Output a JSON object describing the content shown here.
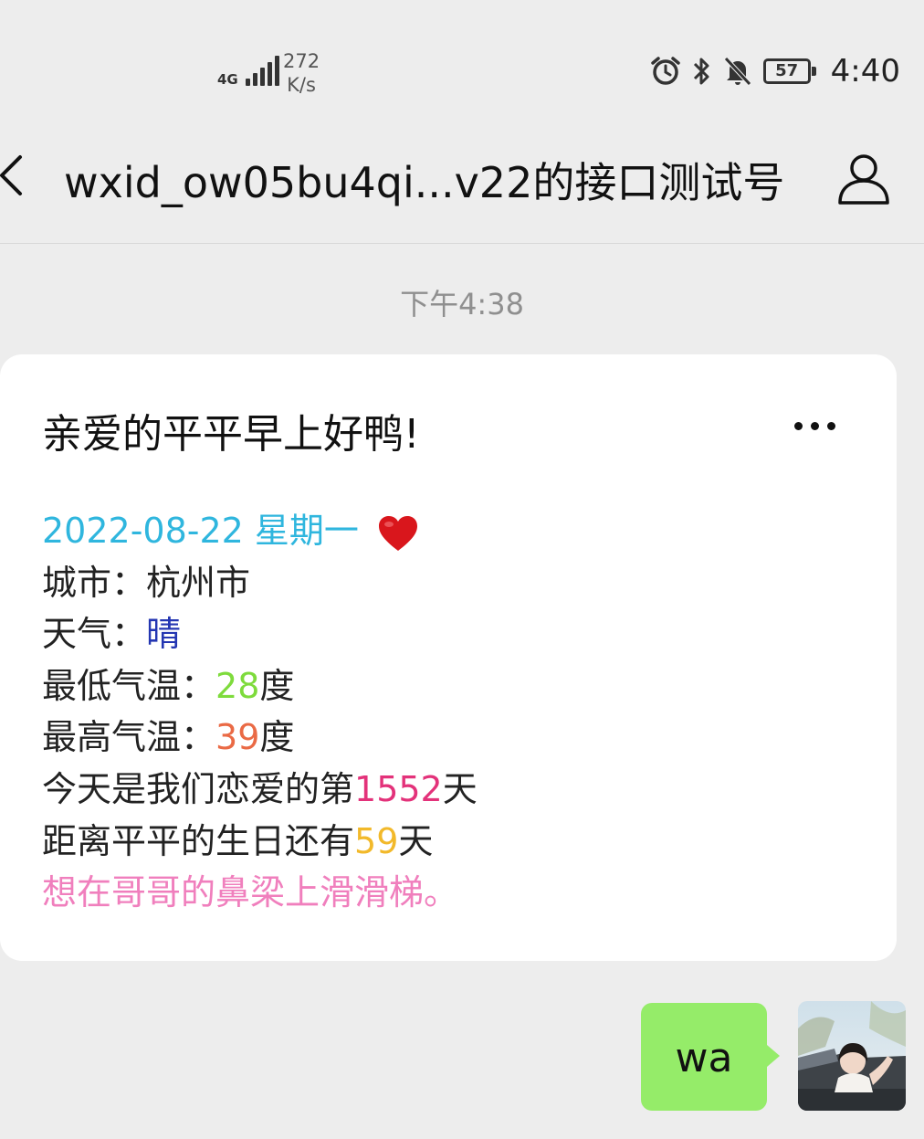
{
  "status_bar": {
    "network": "4G",
    "speed_value": "272",
    "speed_unit": "K/s",
    "battery": "57",
    "time": "4:40"
  },
  "header": {
    "title": "wxid_ow05bu4qi...v22的接口测试号"
  },
  "chat": {
    "timestamp": "下午4:38",
    "message": {
      "title": "亲爱的平平早上好鸭!",
      "date": "2022-08-22  星期一",
      "city_label": "城市：",
      "city": "杭州市",
      "weather_label": "天气：",
      "weather": "晴",
      "low_label": "最低气温：",
      "low_value": "28",
      "high_label": "最高气温：",
      "high_value": "39",
      "temp_unit": "度",
      "love_prefix": "今天是我们恋爱的第",
      "love_days": "1552",
      "day_unit": "天",
      "birthday_prefix": "距离平平的生日还有",
      "birthday_days": "59",
      "quote": "想在哥哥的鼻梁上滑滑梯。"
    },
    "reply": {
      "text": "wa"
    }
  },
  "colors": {
    "date": "#2fb6de",
    "weather": "#2436b2",
    "low": "#7edb3c",
    "high": "#ea6a45",
    "days": "#e3327a",
    "birthday": "#f2b92a",
    "quote": "#f07fbd",
    "bubble": "#95ec69"
  }
}
